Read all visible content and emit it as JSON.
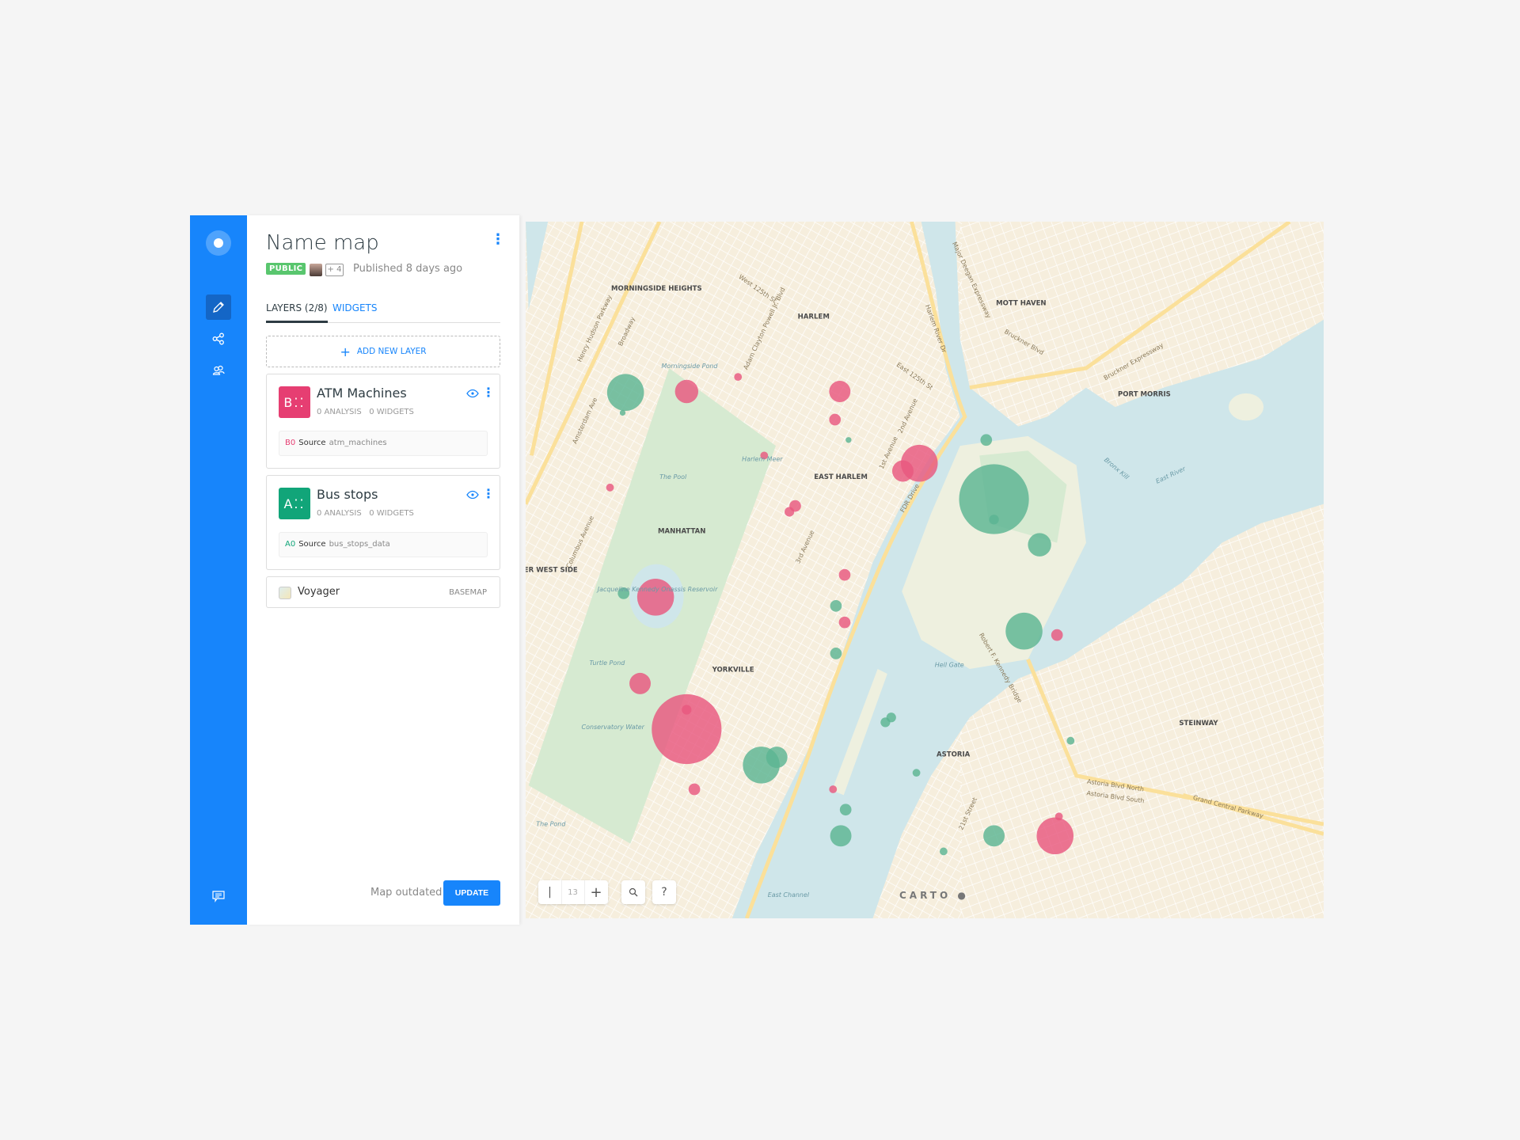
{
  "sidebar": {
    "items": [
      {
        "name": "edit",
        "icon": "pencil-icon",
        "active": true
      },
      {
        "name": "share",
        "icon": "share-icon"
      },
      {
        "name": "collaborators",
        "icon": "users-icon"
      }
    ],
    "footer_icon": "chat-icon",
    "accent": "#1785fb"
  },
  "header": {
    "title": "Name map",
    "visibility": "PUBLIC",
    "collaborators_extra": "+ 4",
    "published": "Published 8 days ago"
  },
  "tabs": [
    {
      "label": "LAYERS (2/8)",
      "active": true
    },
    {
      "label": "WIDGETS"
    }
  ],
  "add_layer_label": "ADD NEW LAYER",
  "layers": [
    {
      "letter": "B",
      "name": "ATM Machines",
      "analysis": "0 ANALYSIS",
      "widgets": "0 WIDGETS",
      "source_id": "B0",
      "source_label": "Source",
      "source": "atm_machines",
      "color": "#e63e72"
    },
    {
      "letter": "A",
      "name": "Bus stops",
      "analysis": "0 ANALYSIS",
      "widgets": "0 WIDGETS",
      "source_id": "A0",
      "source_label": "Source",
      "source": "bus_stops_data",
      "color": "#11a579"
    }
  ],
  "basemap": {
    "name": "Voyager",
    "tag": "BASEMAP"
  },
  "footer": {
    "status": "Map outdated",
    "update_label": "UPDATE"
  },
  "map": {
    "zoom": "13",
    "help": "?",
    "attribution": "CARTO",
    "marker_colors": {
      "atm": "#e8587f",
      "bus": "#5bb592"
    },
    "labels": [
      "MORNINGSIDE HEIGHTS",
      "HARLEM",
      "EAST HARLEM",
      "MANHATTAN",
      "YORKVILLE",
      "MOTT HAVEN",
      "PORT MORRIS",
      "ASTORIA",
      "STEINWAY",
      "Morningside Pond",
      "Harlem Meer",
      "The Pool",
      "Turtle Pond",
      "Conservatory Water",
      "The Pond",
      "Jacqueline Kennedy Onassis Reservoir",
      "Hell Gate",
      "East River",
      "East Channel",
      "Bronx Kill",
      "Broadway",
      "Amsterdam Ave",
      "Columbus Avenue",
      "Henry Hudson Parkway",
      "West 125th St",
      "Adam Clayton Powell Jr. Blvd",
      "East 125th St",
      "Harlem River Dr",
      "Major Deegan Expressway",
      "Bruckner Blvd",
      "Bruckner Expressway",
      "FDR Drive",
      "1st Avenue",
      "2nd Avenue",
      "3rd Avenue",
      "Robert F. Kennedy Bridge",
      "21st Street",
      "Astoria Blvd North",
      "Astoria Blvd South",
      "Grand Central Parkway",
      "UPPER WEST SIDE"
    ]
  }
}
